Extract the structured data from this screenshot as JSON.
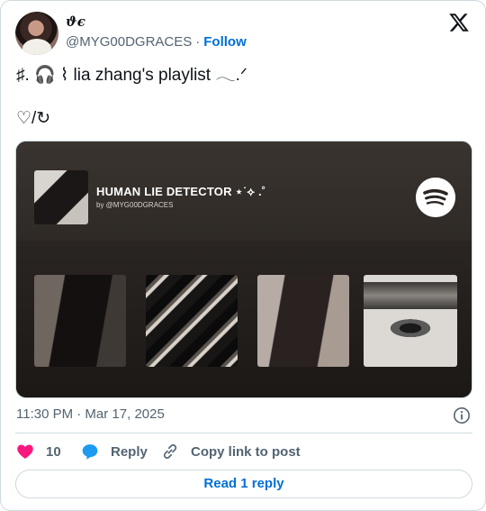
{
  "user": {
    "display_name": "ϑє",
    "handle": "@MYG00DGRACES",
    "separator": "·",
    "follow_label": "Follow",
    "avatar_icon": "profile-photo"
  },
  "tweet": {
    "line1": "♯. 🎧 ⌇ lia zhang's playlist 𓂃.ᐟ",
    "line2": "♡/↻"
  },
  "playlist": {
    "title": "HUMAN LIE DETECTOR ⋆˙⟡ .˚",
    "byline": "by @MYG00DGRACES",
    "service_icon": "spotify-icon",
    "thumbnails": [
      "photo-1",
      "photo-2",
      "photo-3",
      "photo-4"
    ]
  },
  "meta": {
    "timestamp": "11:30 PM · Mar 17, 2025"
  },
  "actions": {
    "like_count": "10",
    "reply_label": "Reply",
    "copy_label": "Copy link to post",
    "read_replies_label": "Read 1 reply"
  },
  "colors": {
    "link": "#006fd6",
    "like": "#f91880",
    "reply": "#1d9bf0",
    "muted": "#536471",
    "border": "#cfd9de"
  }
}
